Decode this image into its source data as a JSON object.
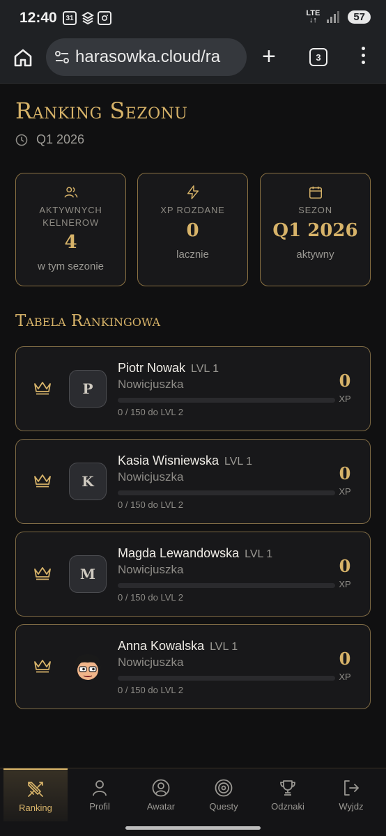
{
  "statusbar": {
    "time": "12:40",
    "calendar_badge": "31",
    "network": "LTE",
    "battery": "57"
  },
  "browser": {
    "url": "harasowka.cloud/ra",
    "tab_count": "3"
  },
  "page": {
    "title": "Ranking Sezonu",
    "season": "Q1 2026"
  },
  "stats": [
    {
      "icon": "users-icon",
      "label": "AKTYWNYCH KELNEROW",
      "value": "4",
      "sub": "w tym sezonie"
    },
    {
      "icon": "lightning-icon",
      "label": "XP ROZDANE",
      "value": "0",
      "sub": "lacznie"
    },
    {
      "icon": "calendar-icon",
      "label": "SEZON",
      "value": "Q1 2026",
      "sub": "aktywny"
    }
  ],
  "ranking": {
    "title": "Tabela Rankingowa",
    "players": [
      {
        "name": "Piotr Nowak",
        "level": "LVL 1",
        "rank": "Nowicjuszka",
        "initial": "P",
        "progress_text": "0 / 150 do LVL 2",
        "progress_fraction": 0,
        "xp": "0",
        "xp_unit": "XP"
      },
      {
        "name": "Kasia Wisniewska",
        "level": "LVL 1",
        "rank": "Nowicjuszka",
        "initial": "K",
        "progress_text": "0 / 150 do LVL 2",
        "progress_fraction": 0,
        "xp": "0",
        "xp_unit": "XP"
      },
      {
        "name": "Magda Lewandowska",
        "level": "LVL 1",
        "rank": "Nowicjuszka",
        "initial": "M",
        "progress_text": "0 / 150 do LVL 2",
        "progress_fraction": 0,
        "xp": "0",
        "xp_unit": "XP"
      },
      {
        "name": "Anna Kowalska",
        "level": "LVL 1",
        "rank": "Nowicjuszka",
        "initial": "",
        "progress_text": "0 / 150 do LVL 2",
        "progress_fraction": 0,
        "xp": "0",
        "xp_unit": "XP"
      }
    ]
  },
  "nav": [
    {
      "label": "Ranking",
      "icon": "swords-icon",
      "active": true
    },
    {
      "label": "Profil",
      "icon": "user-icon",
      "active": false
    },
    {
      "label": "Awatar",
      "icon": "avatar-circle-icon",
      "active": false
    },
    {
      "label": "Questy",
      "icon": "target-icon",
      "active": false
    },
    {
      "label": "Odznaki",
      "icon": "trophy-icon",
      "active": false
    },
    {
      "label": "Wyjdz",
      "icon": "logout-icon",
      "active": false
    }
  ],
  "colors": {
    "gold": "#d7b369",
    "background": "#101011",
    "card": "#18181a"
  }
}
